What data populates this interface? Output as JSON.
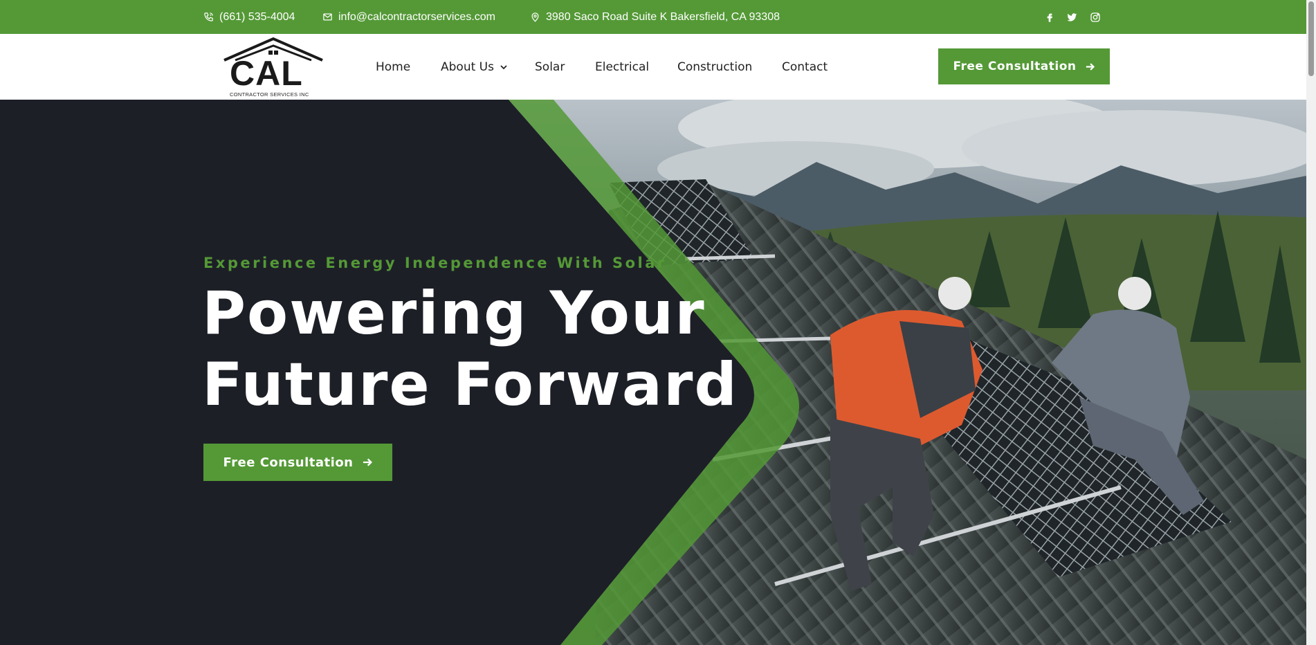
{
  "topbar": {
    "phone": "(661) 535-4004",
    "email": "info@calcontractorservices.com",
    "address": "3980 Saco Road Suite K Bakersfield, CA 93308",
    "social": [
      "facebook-icon",
      "twitter-icon",
      "instagram-icon"
    ],
    "bg_color": "#549936"
  },
  "logo": {
    "text": "CAL",
    "subtitle": "CONTRACTOR SERVICES INC"
  },
  "nav": {
    "items": [
      {
        "label": "Home"
      },
      {
        "label": "About Us",
        "has_dropdown": true
      },
      {
        "label": "Solar"
      },
      {
        "label": "Electrical"
      },
      {
        "label": "Construction"
      },
      {
        "label": "Contact"
      }
    ],
    "cta_label": "Free Consultation"
  },
  "hero": {
    "tagline": "Experience Energy Independence With Solar",
    "headline_line1": "Powering Your",
    "headline_line2": "Future Forward",
    "cta_label": "Free Consultation",
    "accent_color": "#549936",
    "dark_color": "#1d1f27"
  }
}
